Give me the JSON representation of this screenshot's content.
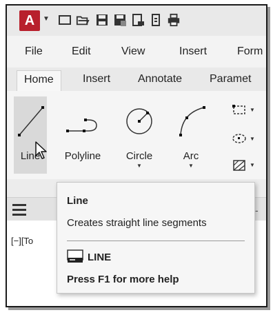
{
  "qat": {
    "app_button": "A",
    "icons": [
      "new-icon",
      "open-icon",
      "save-icon",
      "save-as-icon",
      "export-icon",
      "share-icon",
      "print-icon"
    ]
  },
  "menu": {
    "items": [
      "File",
      "Edit",
      "View",
      "Insert",
      "Form"
    ]
  },
  "ribbon": {
    "tabs": [
      "Home",
      "Insert",
      "Annotate",
      "Paramet"
    ],
    "active_tab": "Home",
    "tools": [
      {
        "label": "Line",
        "icon": "line-icon",
        "hovered": true
      },
      {
        "label": "Polyline",
        "icon": "polyline-icon"
      },
      {
        "label": "Circle",
        "icon": "circle-icon",
        "dropdown": true
      },
      {
        "label": "Arc",
        "icon": "arc-icon",
        "dropdown": true
      }
    ],
    "small_tools": [
      "rectangle-icon",
      "ellipse-icon",
      "hatch-icon"
    ]
  },
  "drawing": {
    "viewport_label": "[−][To"
  },
  "tooltip": {
    "title": "Line",
    "description": "Creates straight line segments",
    "command": "LINE",
    "help": "Press F1 for more help"
  },
  "colors": {
    "app_button": "#b8202c",
    "hover": "#d9d9d9",
    "tooltip_bg": "#f6f6f6"
  }
}
